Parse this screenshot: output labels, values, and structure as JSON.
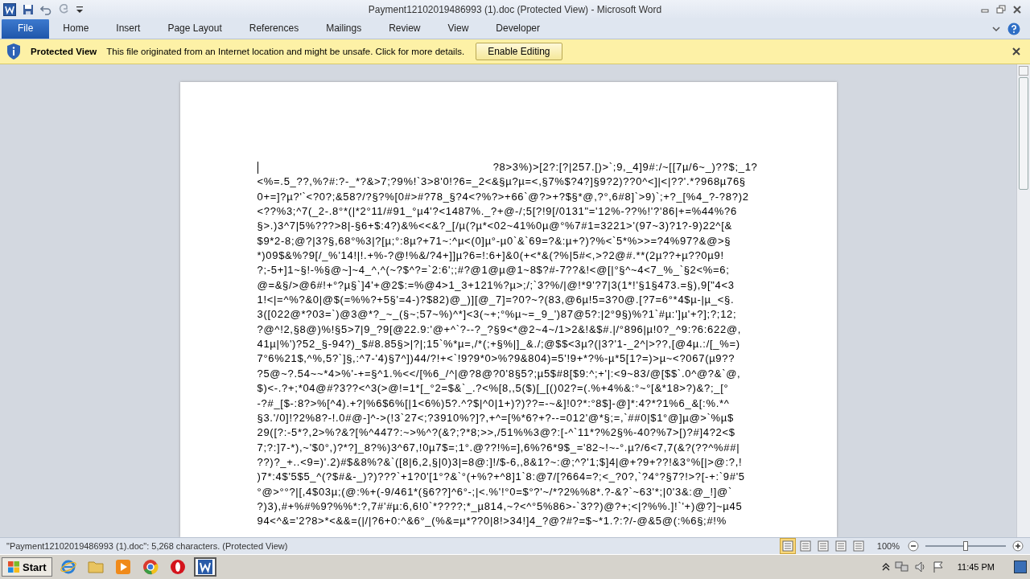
{
  "window": {
    "title": "Payment12102019486993 (1).doc (Protected View)  -  Microsoft Word"
  },
  "tabs": [
    {
      "label": "File",
      "selected": true
    },
    {
      "label": "Home",
      "selected": false
    },
    {
      "label": "Insert",
      "selected": false
    },
    {
      "label": "Page Layout",
      "selected": false
    },
    {
      "label": "References",
      "selected": false
    },
    {
      "label": "Mailings",
      "selected": false
    },
    {
      "label": "Review",
      "selected": false
    },
    {
      "label": "View",
      "selected": false
    },
    {
      "label": "Developer",
      "selected": false
    }
  ],
  "message_bar": {
    "title": "Protected View",
    "message": "This file originated from an Internet location and might be unsafe. Click for more details.",
    "button": "Enable Editing"
  },
  "document": {
    "lines": [
      "?8>3%)>[2?:[?|257.[)>`;9,_4]9#:/~[[7µ/6~_)??$;_1?",
      "<%=.5_??,%?#:?-_*?&>7;?9%!`3>8'0!?6=_2<&§µ?µ=<,§7%$?4?]§9?2)??0^<]|<|??'.*?968µ76§",
      "0+=]?µ?'`<?0?;&58?/?§?%[0#>#?78_§?4<?%?>+66`@?>+?$§*@,?°,6#8]`>9)`;+?_[%4_?-?8?)2",
      "<??%3;^7(_2-.8°*(|*2°11/#91_°µ4'?<1487%._?+@-/;5[?!9[/0131\"='12%-??%!'?'86|+=%44%?6",
      "§>.)3^7|5%???>8|-§6+$:4?)&%<<&?_[/µ(?µ*<02~41%0µ@°%7#1=3221>'(97~3)?1?-9)22^[&",
      "$9*2-8;@?|3?§,68°%3|?[µ;°:8µ?+71~:^µ<(0]µ°-µ0`&`69=?&:µ+?)?%<`5*%>>=?4%97?&@>§",
      "*)09$&%?9[/_%'14!|!.+%-?@!%&/?4+]]µ?6=!:6+]&0(+<*&(?%|5#<,>?2@#.**(2µ??+µ??0µ9!",
      "?;-5+]1~§!-%§@~]~4_^,^(~?$^?=`2:6';;#?@1@µ@1~8$?#-7??&!<@[|°§^~4<7_%_`§2<%=6;",
      "@=&§/>@6#!+°?µ§`]4'+@2$:=%@4>1_3+121%?µ>;/;`3?%/|@!*9'?7|3(1*!'§1§473.=§),9[\"4<3",
      "1!<|=^%?&0|@$(=%%?+5§'=4-)?$82)@_)][@_7]=?0?~?(83,@6µ!5=3?0@.[?7=6°*4$µ-|µ_<§.",
      "3([022@*?03=`)@3@*?_~_(§~;57~%)^*]<3(~+;°%µ~=_9_')87@5?:|2°9§)%?1`#µ:']µ'+?];?;12;",
      "?@^!2,§8@)%!§5>7|9_?9[@22.9:'@+^`?--?_?§9<*@2~4~/1>2&!&$#.|/°896|µ!0?_^9:?6:622@,",
      "41µ|%')?52_§-94?)_$#8.85§>|?|;15`%*µ=,/*(;+§%|]_&./;@$$<3µ?(|3?'1-_2^|>??,[@4µ.:/[_%=)",
      "7°6%21$,^%,5?`]§,:^7-'4)§7^])44/?!+<`!9?9*0>%?9&804)=5'!9+*?%-µ*5[1?=)>µ~<?067(µ9??",
      "?5@~?.54~~*4>%'-+=§^1.%<</[%6_/^|@?8@?0'8§5?;µ5$#8[$9:^;+'|:<9~83/@[$$`.0^@?&`@,",
      "$)<-.?+;*04@#?3??<^3(>@!=1*[_°2=$&`_.?<%[8,,5($)[_[()02?=(.%+4%&:°~°[&*18>?)&?;_[°",
      "-?#_[$-:8?>%[^4).+?|%6$6%[|1<6%)5?.^?$|^0|1+)?)??=-~&]!0?*:°8$]-@]*:4?*?1%6_&[:%.*^",
      "§3.'/0]!?2%8?-!.0#@-]^->(!3`27<;?3910%?]?,+^=[%*6?+?--=012'@*§;=,`##0|$1°@]µ@>`%µ$",
      "29([?:-5*?,2>%?&?[%^447?:~>%^?(&?;?*8;>>,/51%%3@?:[-^`11*?%2§%-40?%7>[)?#]4?2<$",
      "7;?:]7-*),~'$0°,)?*?]_8?%)3^67,!0µ7$=;1°.@??!%=],6%?6*9$_='82~!~-°.µ?/6<7,7(&?(??^%##|",
      "??)?_+..<9=)'.2)#$&8%?&`([8|6,2,§|0)3|=8@:]!/$-6,,8&1?~:@;^?'1;$]4|@+?9+??!&3°%[|>@:?,!",
      ")7*:4$'5$5_^(?$#&-_)?)???`+1?0'[1°?&`°(+%?+^8]1`8:@7/[?664=?;<_?0?,`?4°?§7?!>?[-+:`9#'5",
      "°@>°°?|[,4$03µ;(@:%+(-9/461*(§6??]^6°-;|<.%'!°0=$°?'~/*?2%%8*.?-&?`~63'*;|0'3&:@_!]@`",
      "?)3),#+%#%9?%%*:?,7#'#µ:6,6!0`*????;*_µ814,~?<^°5%86>-`3??)@?+;<|?%%.]!`'+)@?]~µ45",
      "94<^&='2?8>*<&&=(|/|?6+0:^&6°_(%&=µ*??0|8!>34!]4_?@?#?=$~*1.?:?/-@&5@(:%6§;#!%"
    ]
  },
  "status_bar": {
    "text": "\"Payment12102019486993 (1).doc\": 5,268 characters.  (Protected View)",
    "views": [
      {
        "selected": true
      },
      {
        "selected": false
      },
      {
        "selected": false
      },
      {
        "selected": false
      },
      {
        "selected": false
      }
    ],
    "zoom": "100%",
    "zoom_slider": {
      "level": 0.5
    }
  },
  "taskbar": {
    "start": "Start",
    "apps": [
      {
        "kind": "ie",
        "selected": false
      },
      {
        "kind": "folder",
        "selected": false
      },
      {
        "kind": "media",
        "selected": false
      },
      {
        "kind": "chrome",
        "selected": false
      },
      {
        "kind": "opera",
        "selected": false
      },
      {
        "kind": "word",
        "selected": true
      }
    ],
    "time": "11:45 PM"
  }
}
